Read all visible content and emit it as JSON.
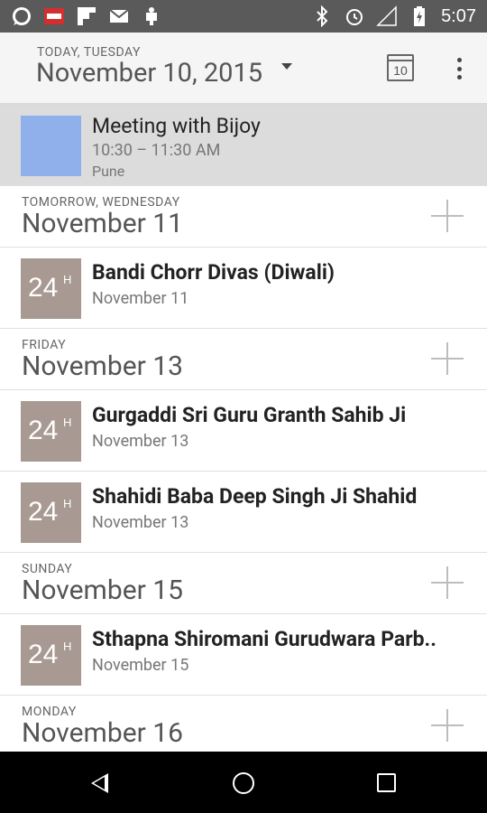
{
  "status_bar": {
    "time": "5:07",
    "left_icons": [
      "whatsapp-icon",
      "app-icon",
      "flipboard-icon",
      "gmail-icon",
      "android-icon"
    ],
    "right_icons": [
      "bluetooth-icon",
      "alarm-icon",
      "signal-icon",
      "battery-icon"
    ]
  },
  "header": {
    "subtitle": "TODAY, TUESDAY",
    "title": "November 10, 2015",
    "calendar_day": "10"
  },
  "today_event": {
    "title": "Meeting with Bijoy",
    "time": "10:30 – 11:30 AM",
    "location": "Pune",
    "color": "#8fb0ea"
  },
  "days": [
    {
      "subtitle": "TOMORROW, WEDNESDAY",
      "title": "November 11",
      "events": [
        {
          "badge": "24",
          "badge_sup": "H",
          "title": "Bandi Chorr Divas (Diwali)",
          "date": "November 11"
        }
      ]
    },
    {
      "subtitle": "FRIDAY",
      "title": "November 13",
      "events": [
        {
          "badge": "24",
          "badge_sup": "H",
          "title": "Gurgaddi Sri Guru Granth Sahib Ji",
          "date": "November 13"
        },
        {
          "badge": "24",
          "badge_sup": "H",
          "title": "Shahidi Baba Deep Singh Ji Shahid",
          "date": "November 13"
        }
      ]
    },
    {
      "subtitle": "SUNDAY",
      "title": "November 15",
      "events": [
        {
          "badge": "24",
          "badge_sup": "H",
          "title": "Sthapna Shiromani Gurudwara Parb..",
          "date": "November 15"
        }
      ]
    },
    {
      "subtitle": "MONDAY",
      "title": "November 16",
      "events": []
    }
  ],
  "colors": {
    "badge": "#a89992",
    "status_bar": "#5a5a5a",
    "app_bar": "#f5f5f5"
  }
}
